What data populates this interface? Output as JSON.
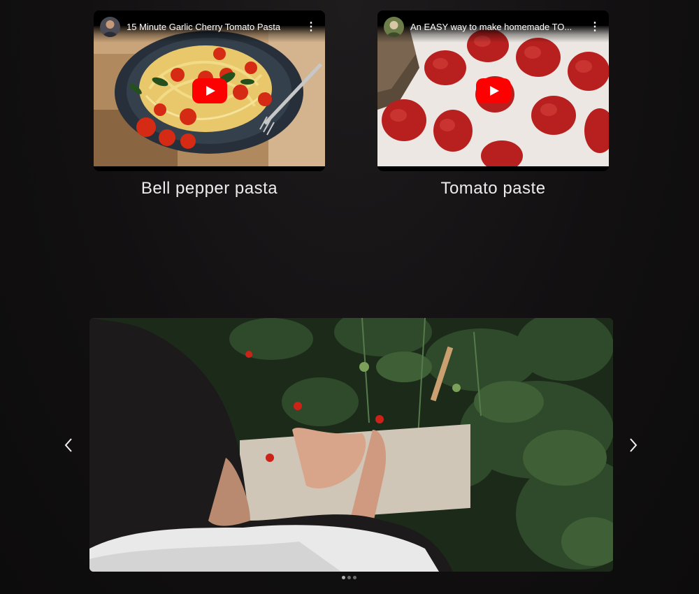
{
  "videos": [
    {
      "title": "15 Minute Garlic Cherry Tomato Pasta",
      "caption": "Bell pepper pasta",
      "icons": {
        "menu": "more-vert-icon",
        "play": "youtube-play-icon"
      }
    },
    {
      "title": "An EASY way to make homemade TO...",
      "caption": "Tomato paste",
      "icons": {
        "menu": "more-vert-icon",
        "play": "youtube-play-icon"
      }
    }
  ],
  "slider": {
    "prev_icon": "chevron-left-icon",
    "next_icon": "chevron-right-icon",
    "slide_count": 3,
    "active_slide": 1
  },
  "colors": {
    "youtube_red": "#ff0000",
    "caption_text": "#ececec",
    "page_background": "#121011"
  }
}
